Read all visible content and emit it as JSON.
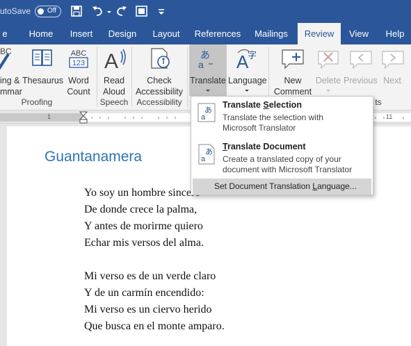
{
  "title_bar": {
    "autosave_label": "AutoSave",
    "autosave_state": "Off"
  },
  "tabs": [
    {
      "label": "e"
    },
    {
      "label": "Home"
    },
    {
      "label": "Insert"
    },
    {
      "label": "Design"
    },
    {
      "label": "Layout"
    },
    {
      "label": "References"
    },
    {
      "label": "Mailings"
    },
    {
      "label": "Review"
    },
    {
      "label": "View"
    },
    {
      "label": "Help"
    }
  ],
  "ribbon": {
    "spelling": {
      "line1": "ing &",
      "line2": "mmar"
    },
    "thesaurus": {
      "label": "Thesaurus"
    },
    "word_count": {
      "line1": "Word",
      "line2": "Count"
    },
    "read_aloud": {
      "line1": "Read",
      "line2": "Aloud"
    },
    "check_accessibility": {
      "line1": "Check",
      "line2": "Accessibility"
    },
    "translate": {
      "label": "Translate"
    },
    "language": {
      "label": "Language"
    },
    "new_comment": {
      "line1": "New",
      "line2": "Comment"
    },
    "delete": {
      "label": "Delete"
    },
    "previous": {
      "label": "Previous"
    },
    "next": {
      "label": "Next"
    },
    "groups": {
      "proofing": "Proofing",
      "speech": "Speech",
      "accessibility": "Accessibility",
      "comments": "ts"
    },
    "word_count_icon_text": "ABC",
    "word_count_icon_num": "123",
    "spelling_icon_text": "BC"
  },
  "ruler": {
    "numbers": [
      "1",
      "11"
    ]
  },
  "document": {
    "heading": "Guantanamera",
    "stanza1": [
      "Yo soy un hombre sincero",
      "De donde crece la palma,",
      "Y antes de morirme quiero",
      "Echar mis versos del alma."
    ],
    "stanza2": [
      "Mi verso es de un verde claro",
      "Y de un carmín encendido:",
      "Mi verso es un ciervo herido",
      "Que busca en el monte amparo."
    ]
  },
  "translate_menu": {
    "selection": {
      "title_pre": "Translate ",
      "title_ul": "S",
      "title_post": "election",
      "desc1": "Translate the selection with",
      "desc2": "Microsoft Translator"
    },
    "document": {
      "title_ul": "T",
      "title_post": "ranslate Document",
      "desc1": "Create a translated copy of your",
      "desc2": "document with Microsoft Translator"
    },
    "set_language": {
      "pre": "Set Document Translation ",
      "ul": "L",
      "post": "anguage..."
    }
  },
  "colors": {
    "title_blue": "#2b579a",
    "heading_blue": "#2e74b5",
    "menu_highlight": "#d5d5d5"
  }
}
